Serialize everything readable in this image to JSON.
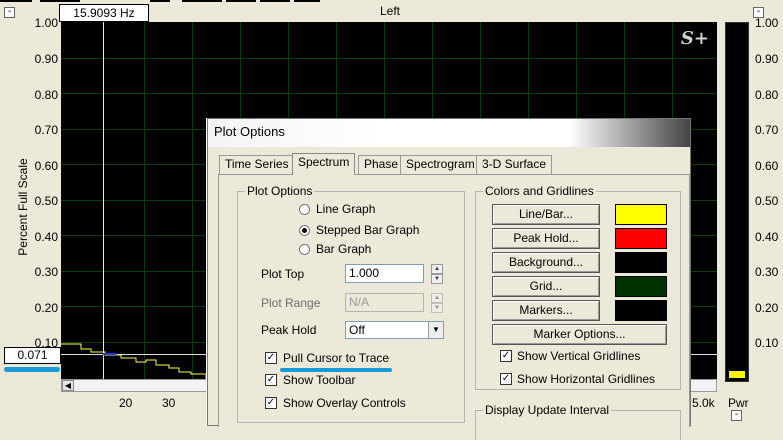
{
  "analyzer": {
    "channel_title": "Left",
    "frequency_readout": "15.9093 Hz",
    "y_axis_label": "Percent Full Scale",
    "y_ticks": [
      "1.00",
      "0.90",
      "0.80",
      "0.70",
      "0.60",
      "0.50",
      "0.40",
      "0.30",
      "0.20",
      "0.10"
    ],
    "x_ticks": [
      "20",
      "30",
      "5.0k"
    ],
    "level_readout": "0.071",
    "logo": "S+",
    "collapse_symbol": "-"
  },
  "power_meter": {
    "label": "Pwr",
    "ticks": [
      "1.00",
      "0.90",
      "0.80",
      "0.70",
      "0.60",
      "0.50",
      "0.40",
      "0.30",
      "0.20",
      "0.10"
    ],
    "level": 0.02,
    "fill_color": "#f5f500"
  },
  "dialog": {
    "title": "Plot Options",
    "tabs": [
      {
        "label": "Time Series"
      },
      {
        "label": "Spectrum"
      },
      {
        "label": "Phase"
      },
      {
        "label": "Spectrogram"
      },
      {
        "label": "3-D Surface"
      }
    ],
    "active_tab": "Spectrum",
    "plot_options": {
      "legend": "Plot Options",
      "radios": [
        {
          "label": "Line Graph",
          "selected": false
        },
        {
          "label": "Stepped Bar Graph",
          "selected": true
        },
        {
          "label": "Bar Graph",
          "selected": false
        }
      ],
      "plot_top_label": "Plot Top",
      "plot_top_value": "1.000",
      "plot_range_label": "Plot Range",
      "plot_range_value": "N/A",
      "peak_hold_label": "Peak Hold",
      "peak_hold_value": "Off",
      "checkboxes": [
        {
          "label": "Pull Cursor to Trace",
          "checked": true
        },
        {
          "label": "Show Toolbar",
          "checked": true
        },
        {
          "label": "Show Overlay Controls",
          "checked": true
        }
      ]
    },
    "colors": {
      "legend": "Colors and Gridlines",
      "buttons": [
        {
          "label": "Line/Bar...",
          "swatch": "#ffff00"
        },
        {
          "label": "Peak Hold...",
          "swatch": "#ff0000"
        },
        {
          "label": "Background...",
          "swatch": "#000000"
        },
        {
          "label": "Grid...",
          "swatch": "#003300"
        },
        {
          "label": "Markers...",
          "swatch": "#000000"
        }
      ],
      "marker_options_label": "Marker Options...",
      "checkboxes": [
        {
          "label": "Show Vertical Gridlines",
          "checked": true
        },
        {
          "label": "Show Horizontal Gridlines",
          "checked": true
        }
      ]
    },
    "display_update_legend": "Display Update Interval"
  },
  "check_mark": "✓",
  "spin_up": "▲",
  "spin_down": "▼",
  "dropdown_arrow": "▼",
  "scroll_left": "◀",
  "accent_color": "#1a9ad6"
}
